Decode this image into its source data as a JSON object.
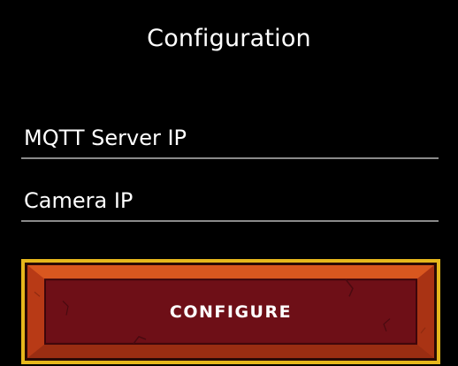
{
  "screen": {
    "title": "Configuration"
  },
  "form": {
    "mqtt_server_ip": {
      "placeholder": "MQTT Server IP",
      "value": ""
    },
    "camera_ip": {
      "placeholder": "Camera IP",
      "value": ""
    },
    "configure_button_label": "CONFIGURE"
  },
  "colors": {
    "background": "#000000",
    "text": "#ffffff",
    "field_underline": "#8a8a8a",
    "button_frame": "#e6b71c",
    "button_bevel": "#c8461a",
    "button_face": "#6e0f17"
  }
}
